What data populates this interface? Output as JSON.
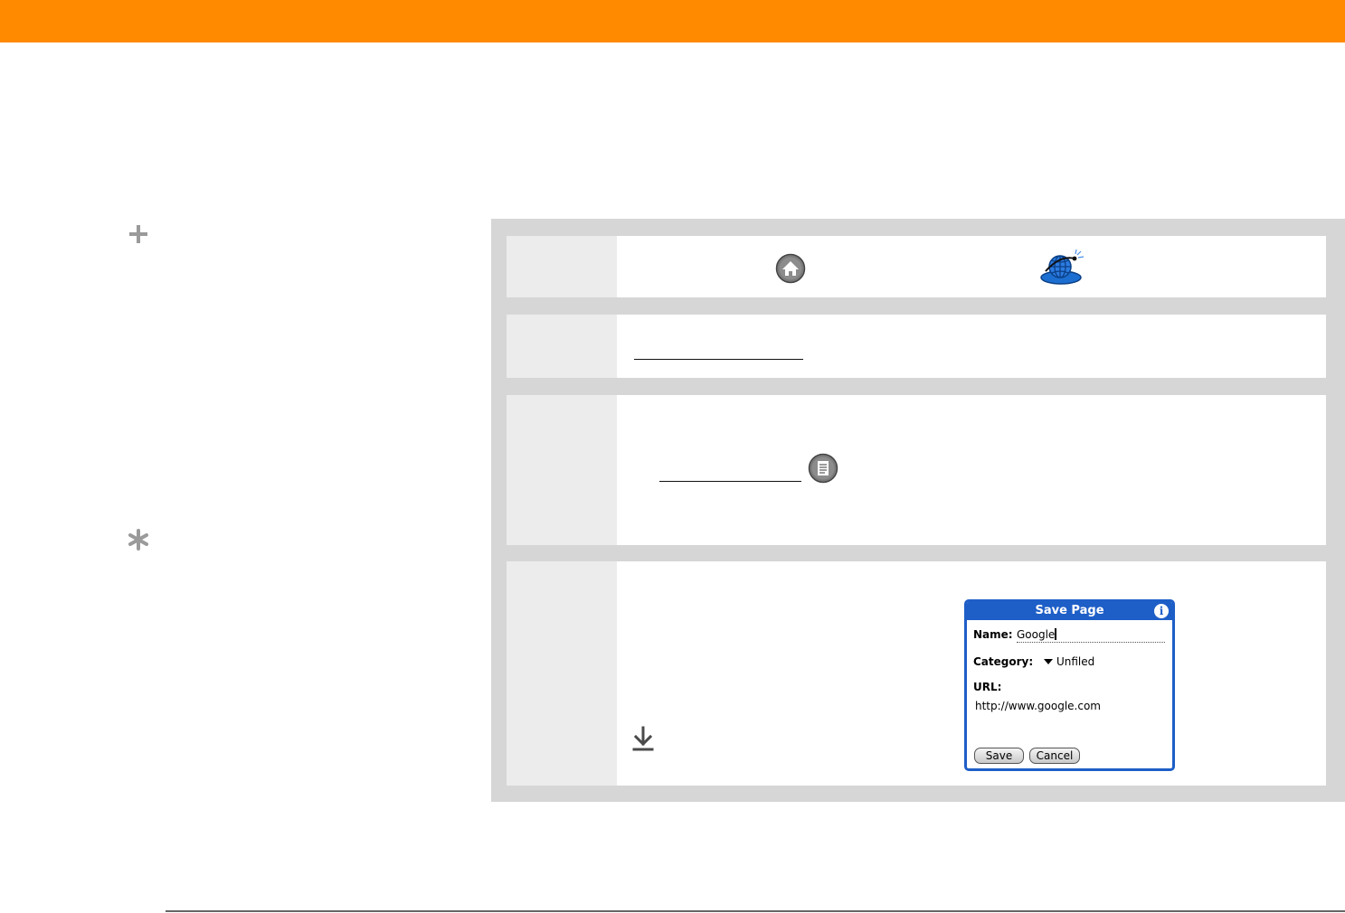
{
  "colors": {
    "header_bar": "#ff8a00",
    "panel": "#d6d6d6",
    "step_number_cell": "#ececec",
    "dialog_blue": "#1e5ec7"
  },
  "sidebar": {
    "icons": [
      "plus-icon",
      "asterisk-icon"
    ]
  },
  "steps": [
    {
      "icons": [
        "home-icon",
        "web-browser-icon"
      ]
    },
    {
      "links": 1
    },
    {
      "icons": [
        "menu-icon"
      ],
      "links": 1
    },
    {
      "icons": [
        "download-arrow-icon"
      ]
    }
  ],
  "dialog": {
    "title": "Save Page",
    "info_icon": "i",
    "name_label": "Name:",
    "name_value": "Google",
    "category_label": "Category:",
    "category_value": "Unfiled",
    "url_label": "URL:",
    "url_value": "http://www.google.com",
    "save_label": "Save",
    "cancel_label": "Cancel"
  }
}
